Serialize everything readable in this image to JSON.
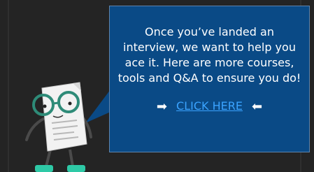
{
  "promo": {
    "message": "Once you’ve landed an interview, we want to help you ace it. Here are more courses, tools and Q&A to ensure you do!",
    "cta_label": "CLICK HERE",
    "left_arrow_icon": "right-arrow-icon",
    "right_arrow_icon": "left-arrow-icon",
    "left_arrow_glyph": "➡",
    "right_arrow_glyph": "⬅"
  },
  "colors": {
    "background": "#242424",
    "bubble": "#0a4a86",
    "link": "#3aa3ff",
    "glasses": "#2e8b78",
    "shoes": "#2ec9a6"
  },
  "mascot": {
    "icon": "paper-mascot-illustration"
  }
}
